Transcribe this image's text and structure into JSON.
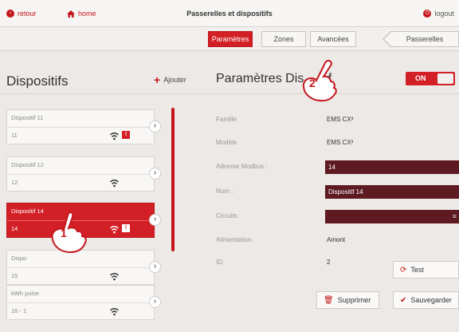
{
  "topbar": {
    "back_label": "retour",
    "home_label": "home",
    "title": "Passerelles et dispositifs",
    "logout_label": "logout"
  },
  "tabs": {
    "params": "Paramètres",
    "zones": "Zones",
    "avancees": "Avancées",
    "passerelles": "Passerelles",
    "active": "Paramètres"
  },
  "left": {
    "title": "Dispositifs",
    "add_label": "Ajouter",
    "devices": [
      {
        "name": "Dispositif 11",
        "num": "11",
        "wifi_icon": "wifi-icon",
        "alert": "!"
      },
      {
        "name": "Dispositif 12",
        "num": "12",
        "wifi_icon": "wifi-icon"
      },
      {
        "name": "Dispositif 14",
        "num": "14",
        "wifi_icon": "wifi-icon",
        "alert": "!",
        "selected": true
      },
      {
        "name": "Dispo",
        "num": "15",
        "wifi_icon": "wifi-icon"
      },
      {
        "name": "kWh pulse",
        "num": "16 - 1",
        "wifi_icon": "wifi-icon"
      }
    ]
  },
  "right": {
    "title": "Paramètres Dis",
    "title_tail": "f",
    "toggle_label": "ON",
    "famille_label": "Famille",
    "famille_value": "EMS CX³",
    "modele_label": "Modèle",
    "modele_value": "EMS CX³",
    "modbus_label": "Adresse Modbus :",
    "modbus_value": "14",
    "nom_label": "Nom :",
    "nom_value": "Dispositif 14",
    "circuits_label": "Circuits :",
    "alimentation_label": "Alimentation:",
    "alimentation_value": "Amont",
    "id_label": "ID:",
    "id_value": "2",
    "test_label": "Test",
    "delete_label": "Supprimer",
    "save_label": "Sauvegarder"
  },
  "annotations": {
    "step1": "1",
    "step2": "2"
  },
  "colors": {
    "accent": "#d31f26",
    "field_bg": "#5e1a21",
    "page_bg": "#ece9e6"
  }
}
